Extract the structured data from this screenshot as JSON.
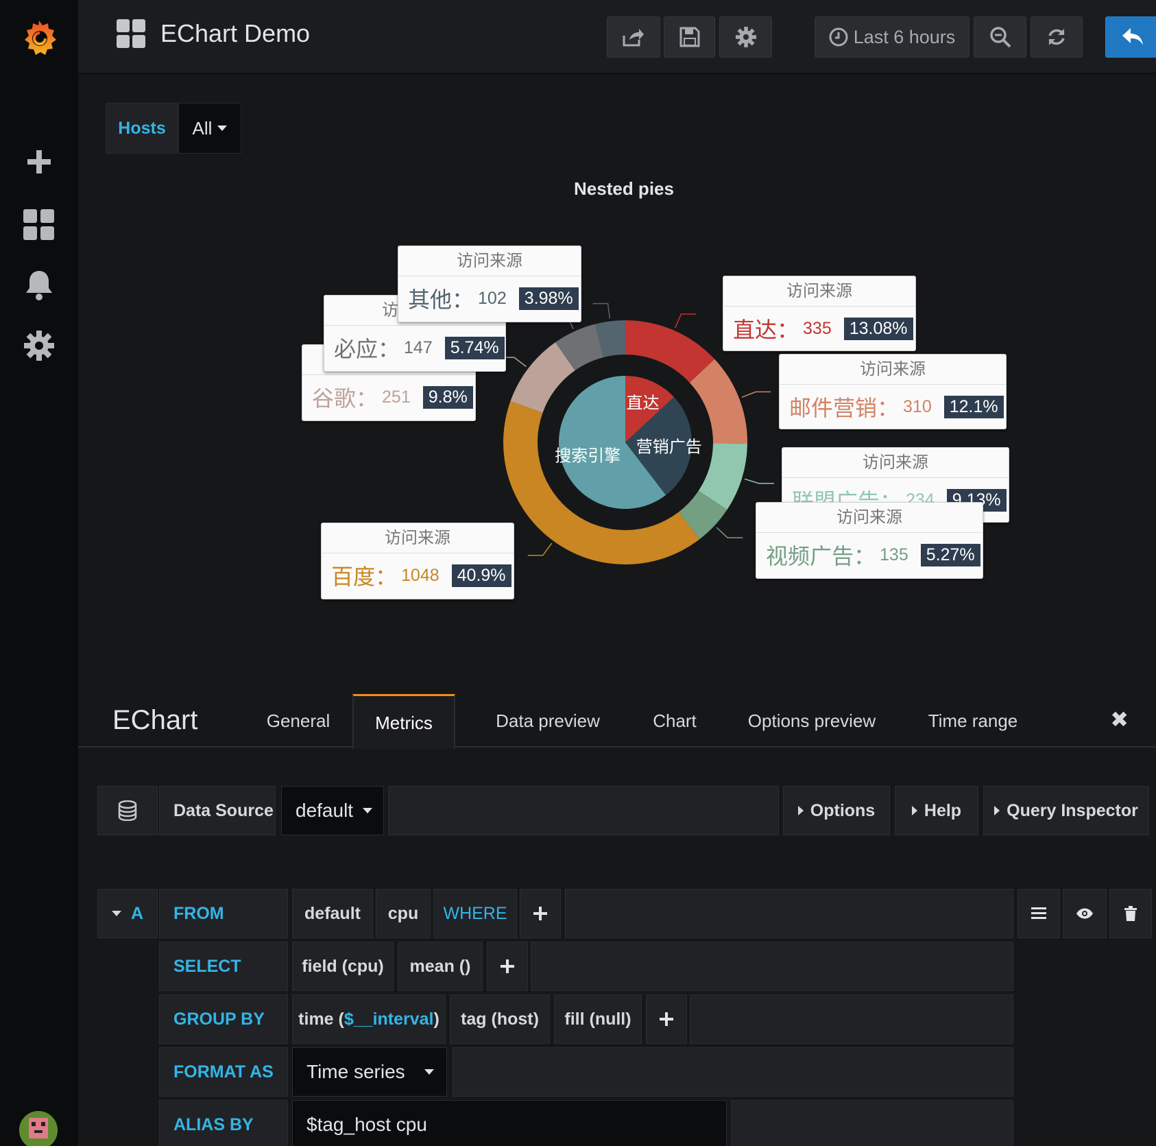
{
  "dashboard": {
    "title": "EChart Demo"
  },
  "timepicker": {
    "label": "Last 6 hours"
  },
  "variables": {
    "label": "Hosts",
    "value": "All"
  },
  "chart": {
    "title": "Nested pies"
  },
  "chart_data": {
    "type": "pie",
    "title": "Nested pies",
    "series": [
      {
        "name": "",
        "radius": "inner",
        "items": [
          {
            "name": "直达",
            "value": 335
          },
          {
            "name": "营销广告",
            "value": 679
          },
          {
            "name": "搜索引擎",
            "value": 1548
          }
        ]
      },
      {
        "name": "访问来源",
        "radius": "outer",
        "items": [
          {
            "name": "直达",
            "value": 335,
            "percent": "13.08%"
          },
          {
            "name": "邮件营销",
            "value": 310,
            "percent": "12.1%"
          },
          {
            "name": "联盟广告",
            "value": 234,
            "percent": "9.13%"
          },
          {
            "name": "视频广告",
            "value": 135,
            "percent": "5.27%"
          },
          {
            "name": "百度",
            "value": 1048,
            "percent": "40.9%"
          },
          {
            "name": "谷歌",
            "value": 251,
            "percent": "9.8%"
          },
          {
            "name": "必应",
            "value": 147,
            "percent": "5.74%"
          },
          {
            "name": "其他",
            "value": 102,
            "percent": "3.98%"
          }
        ]
      }
    ],
    "colors": {
      "直达": "#c23531",
      "邮件营销": "#d48265",
      "联盟广告": "#91c7ae",
      "视频广告": "#749f83",
      "百度": "#ca8622",
      "谷歌": "#bda29a",
      "必应": "#6e7074",
      "其他": "#546570",
      "营销广告": "#2f4554",
      "搜索引擎": "#61a0a8"
    }
  },
  "tooltips": {
    "series_name": "访问来源",
    "other": {
      "label": "其他：",
      "value": "102",
      "pct": "3.98%"
    },
    "bing": {
      "label": "必应：",
      "value": "147",
      "pct": "5.74%"
    },
    "google": {
      "label": "谷歌：",
      "value": "251",
      "pct": "9.8%"
    },
    "direct": {
      "label": "直达：",
      "value": "335",
      "pct": "13.08%"
    },
    "email": {
      "label": "邮件营销：",
      "value": "310",
      "pct": "12.1%"
    },
    "union": {
      "label": "联盟广告：",
      "value": "234",
      "pct": "9.13%"
    },
    "video": {
      "label": "视频广告：",
      "value": "135",
      "pct": "5.27%"
    },
    "baidu": {
      "label": "百度：",
      "value": "1048",
      "pct": "40.9%"
    }
  },
  "editor": {
    "panel_name": "EChart",
    "tabs": [
      "General",
      "Metrics",
      "Data preview",
      "Chart",
      "Options preview",
      "Time range"
    ],
    "close": "✖",
    "datasource_label": "Data Source",
    "datasource_value": "default",
    "options_label": "Options",
    "help_label": "Help",
    "inspector_label": "Query Inspector"
  },
  "query": {
    "ref_id": "A",
    "from_kw": "FROM",
    "from_policy": "default",
    "from_measurement": "cpu",
    "where_kw": "WHERE",
    "select_kw": "SELECT",
    "select_field": "field (cpu)",
    "select_fn": "mean ()",
    "groupby_kw": "GROUP BY",
    "groupby_time_prefix": "time (",
    "groupby_time_var": "$__interval",
    "groupby_time_suffix": ")",
    "groupby_tag": "tag (host)",
    "groupby_fill": "fill (null)",
    "format_kw": "FORMAT AS",
    "format_value": "Time series",
    "alias_kw": "ALIAS BY",
    "alias_value": "$tag_host cpu"
  }
}
